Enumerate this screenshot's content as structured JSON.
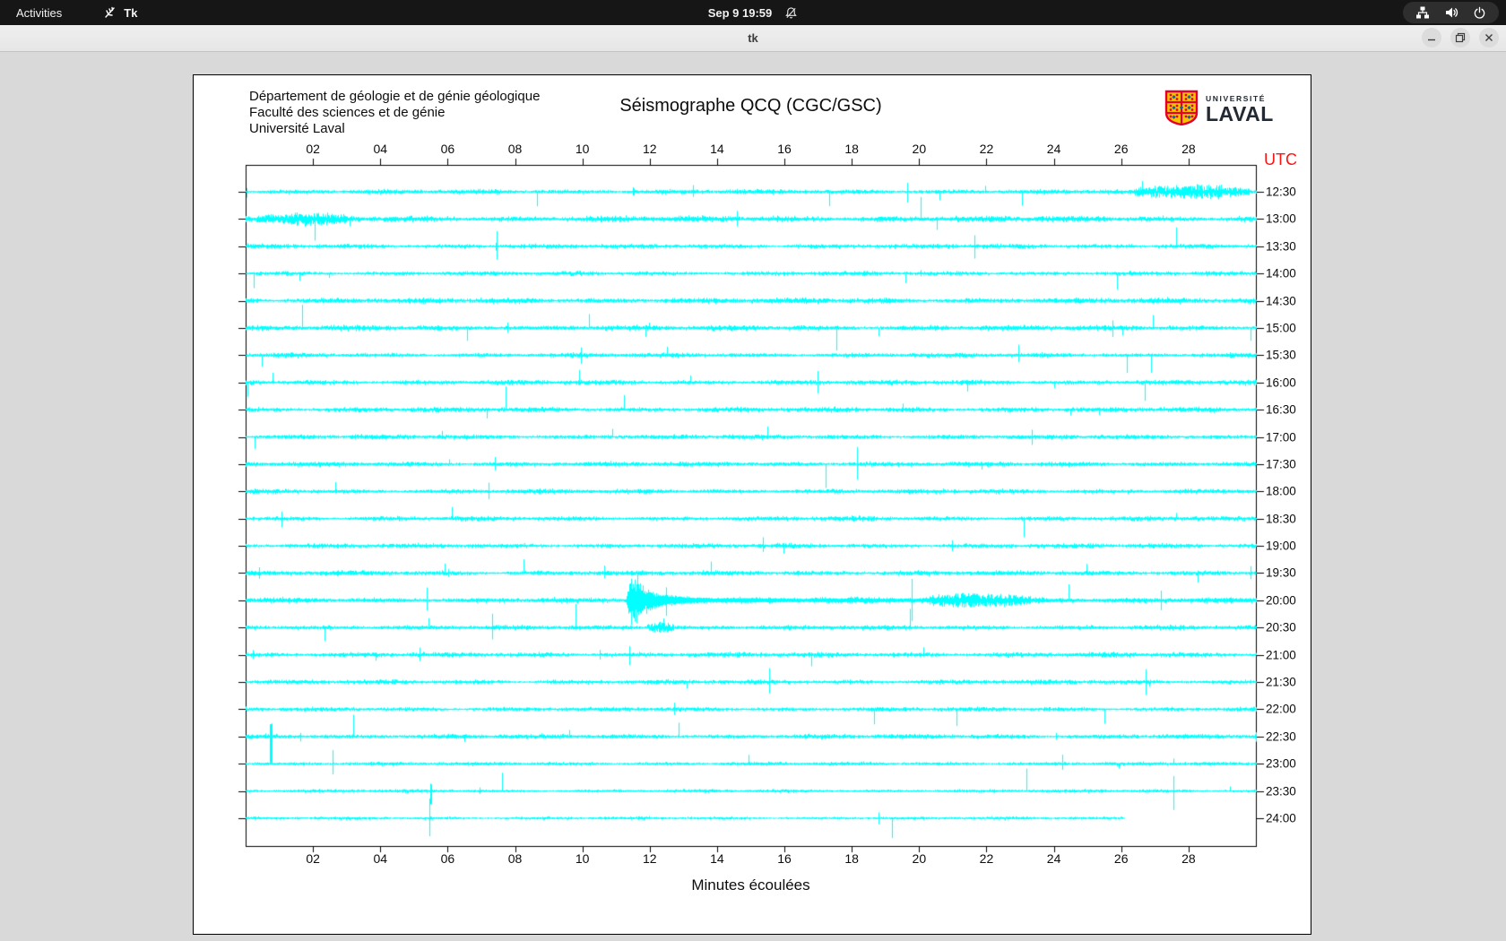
{
  "topbar": {
    "activities_label": "Activities",
    "app_indicator_label": "Tk",
    "clock": "Sep 9 19:59"
  },
  "titlebar": {
    "title": "tk"
  },
  "seismograph": {
    "institution_lines": [
      "Département de géologie et de génie géologique",
      "Faculté des sciences et de génie",
      "Université Laval"
    ],
    "title": "Séismographe QCQ (CGC/GSC)",
    "utc_label": "UTC",
    "xlabel": "Minutes écoulées",
    "logo": {
      "line1": "UNIVERSITÉ",
      "line2": "LAVAL"
    },
    "colors": {
      "trace": "#00ffff",
      "utc_label": "#fb1413",
      "axis": "#000000",
      "plot_background": "#ffffff",
      "window_background": "#d9d9d9"
    },
    "chart_data": {
      "type": "line",
      "subtype": "helicorder",
      "x_range_minutes": [
        0,
        30
      ],
      "x_tick_labels": [
        "02",
        "04",
        "06",
        "08",
        "10",
        "12",
        "14",
        "16",
        "18",
        "20",
        "22",
        "24",
        "26",
        "28"
      ],
      "row_labels_utc": [
        "12:30",
        "13:00",
        "13:30",
        "14:00",
        "14:30",
        "15:00",
        "15:30",
        "16:00",
        "16:30",
        "17:00",
        "17:30",
        "18:00",
        "18:30",
        "19:00",
        "19:30",
        "20:00",
        "20:30",
        "21:00",
        "21:30",
        "22:00",
        "22:30",
        "23:00",
        "23:30",
        "24:00"
      ],
      "row_noise_level": [
        1.5,
        1.9,
        1.5,
        1.4,
        1.8,
        1.7,
        1.5,
        1.6,
        1.6,
        1.5,
        1.6,
        1.5,
        1.5,
        1.5,
        1.6,
        1.7,
        1.5,
        1.6,
        1.5,
        1.4,
        1.5,
        1.2,
        1.1,
        1.0
      ],
      "events": [
        {
          "row": 0,
          "type": "burst",
          "start": 26.4,
          "end": 29.8,
          "amp": 7
        },
        {
          "row": 1,
          "type": "burst",
          "start": 0.3,
          "end": 3.0,
          "amp": 5
        },
        {
          "row": 15,
          "type": "quake",
          "start": 11.3,
          "peak_amp": 33,
          "rise": 0.15,
          "decay": 0.45
        },
        {
          "row": 15,
          "type": "burst",
          "start": 20.3,
          "end": 23.3,
          "amp": 6
        },
        {
          "row": 16,
          "type": "burst",
          "start": 11.9,
          "end": 12.7,
          "amp": 6
        },
        {
          "row": 20,
          "type": "spike",
          "at": 0.75,
          "amp": 28
        },
        {
          "row": 22,
          "type": "spike",
          "at": 5.5,
          "amp": 14
        }
      ],
      "last_trace_end_minute": 26.1,
      "seed": 20240909
    }
  }
}
